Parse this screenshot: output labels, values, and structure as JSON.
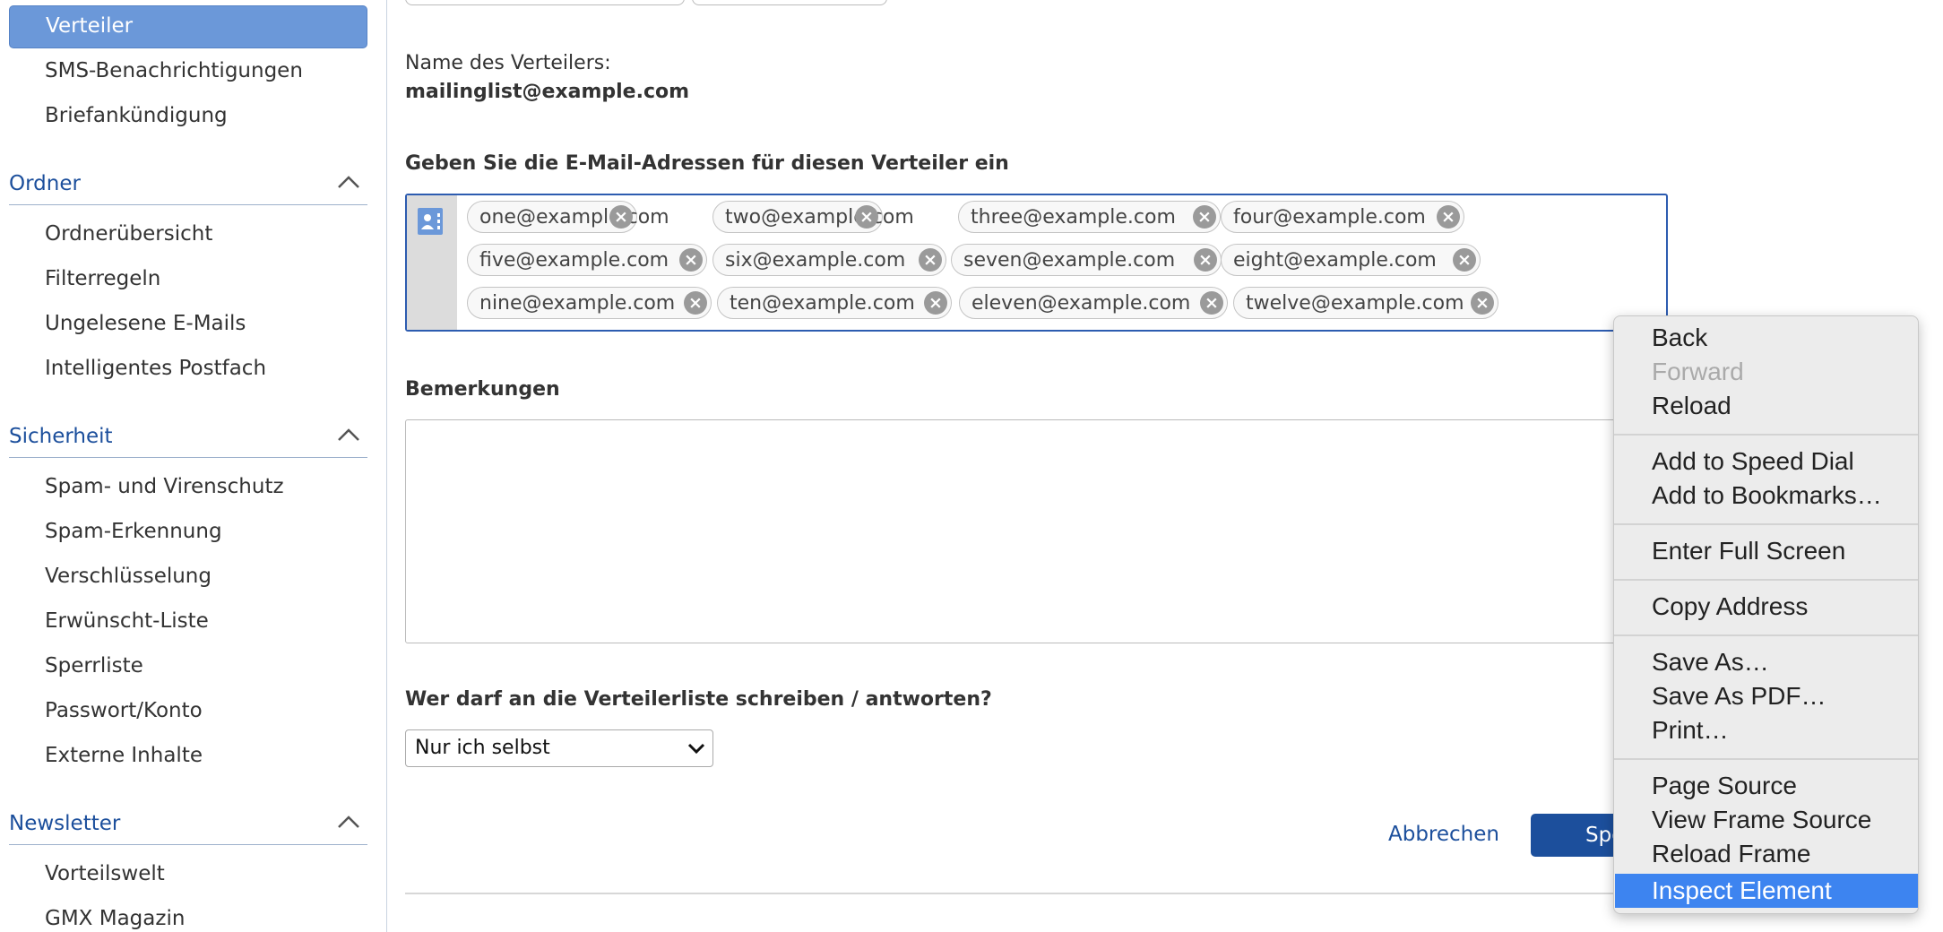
{
  "sidebar": {
    "active_item": "Verteiler",
    "items_top": [
      "SMS-Benachrichtigungen",
      "Briefankündigung"
    ],
    "sections": [
      {
        "label": "Ordner",
        "items": [
          "Ordnerübersicht",
          "Filterregeln",
          "Ungelesene E-Mails",
          "Intelligentes Postfach"
        ]
      },
      {
        "label": "Sicherheit",
        "items": [
          "Spam- und Virenschutz",
          "Spam-Erkennung",
          "Verschlüsselung",
          "Erwünscht-Liste",
          "Sperrliste",
          "Passwort/Konto",
          "Externe Inhalte"
        ]
      },
      {
        "label": "Newsletter",
        "items": [
          "Vorteilswelt",
          "GMX Magazin"
        ]
      }
    ]
  },
  "main": {
    "list_name_label": "Name des Verteilers:",
    "list_name_value": "mailinglist@example.com",
    "emails_heading": "Geben Sie die E-Mail-Adressen für diesen Verteiler ein",
    "emails": [
      "one@example.com",
      "two@example.com",
      "three@example.com",
      "four@example.com",
      "five@example.com",
      "six@example.com",
      "seven@example.com",
      "eight@example.com",
      "nine@example.com",
      "ten@example.com",
      "eleven@example.com",
      "twelve@example.com"
    ],
    "remarks_heading": "Bemerkungen",
    "remarks_value": "",
    "permission_heading": "Wer darf an die Verteilerliste schreiben / antworten?",
    "permission_selected": "Nur ich selbst",
    "cancel_label": "Abbrechen",
    "save_label": "Speich"
  },
  "context_menu": {
    "items": {
      "back": "Back",
      "forward": "Forward",
      "reload": "Reload",
      "speed_dial": "Add to Speed Dial",
      "bookmarks": "Add to Bookmarks…",
      "full_screen": "Enter Full Screen",
      "copy_address": "Copy Address",
      "save_as": "Save As…",
      "save_pdf": "Save As PDF…",
      "print": "Print…",
      "page_source": "Page Source",
      "frame_source": "View Frame Source",
      "reload_frame": "Reload Frame",
      "inspect": "Inspect Element"
    },
    "disabled": [
      "Forward"
    ],
    "highlighted": "Inspect Element"
  },
  "colors": {
    "accent": "#6b98d9",
    "link": "#1c4f9c",
    "menu_highlight": "#3d84f0"
  }
}
